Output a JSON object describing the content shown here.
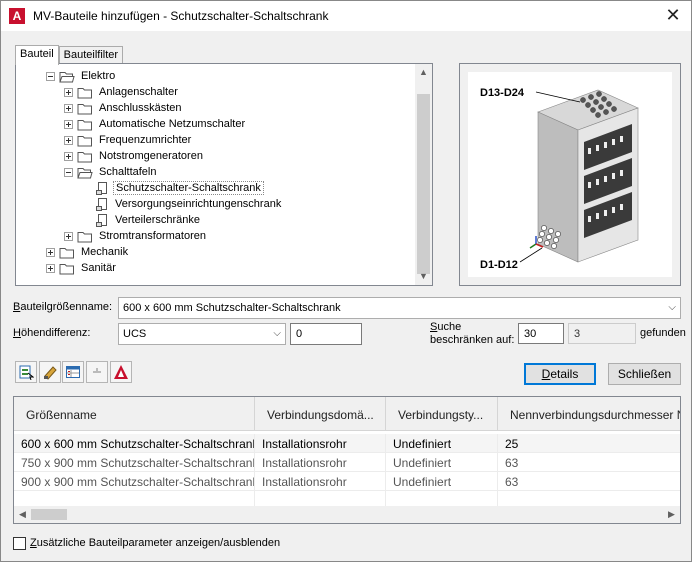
{
  "window": {
    "title": "MV-Bauteile hinzufügen - Schutzschalter-Schaltschrank",
    "app_icon_letter": "A",
    "close_glyph": "✕"
  },
  "tabs": [
    {
      "label": "Bauteil",
      "active": true
    },
    {
      "label": "Bauteilfilter",
      "active": false
    }
  ],
  "tree": [
    {
      "label": "Elektro",
      "level": 1,
      "expander": "minus",
      "icon": "folder-open"
    },
    {
      "label": "Anlagenschalter",
      "level": 2,
      "expander": "plus",
      "icon": "folder"
    },
    {
      "label": "Anschlusskästen",
      "level": 2,
      "expander": "plus",
      "icon": "folder"
    },
    {
      "label": "Automatische Netzumschalter",
      "level": 2,
      "expander": "plus",
      "icon": "folder"
    },
    {
      "label": "Frequenzumrichter",
      "level": 2,
      "expander": "plus",
      "icon": "folder"
    },
    {
      "label": "Notstromgeneratoren",
      "level": 2,
      "expander": "plus",
      "icon": "folder"
    },
    {
      "label": "Schalttafeln",
      "level": 2,
      "expander": "minus",
      "icon": "folder-open"
    },
    {
      "label": "Schutzschalter-Schaltschrank",
      "level": 3,
      "expander": "none",
      "icon": "file",
      "selected": true
    },
    {
      "label": "Versorgungseinrichtungenschrank",
      "level": 3,
      "expander": "none",
      "icon": "file"
    },
    {
      "label": "Verteilerschränke",
      "level": 3,
      "expander": "none",
      "icon": "file"
    },
    {
      "label": "Stromtransformatoren",
      "level": 2,
      "expander": "plus",
      "icon": "folder"
    },
    {
      "label": "Mechanik",
      "level": 1,
      "expander": "plus",
      "icon": "folder"
    },
    {
      "label": "Sanitär",
      "level": 1,
      "expander": "plus",
      "icon": "folder"
    }
  ],
  "preview": {
    "label_top": "D13-D24",
    "label_bottom": "D1-D12"
  },
  "form": {
    "size_label_u": "B",
    "size_label_rest": "auteilgrößenname:",
    "size_value": "600 x 600 mm Schutzschalter-Schaltschrank",
    "height_label_u": "H",
    "height_label_rest": "öhendifferenz:",
    "height_combo": "UCS",
    "height_value": "0",
    "search_label_line1_u": "S",
    "search_label_line1_rest": "uche",
    "search_label_line2": "beschränken auf:",
    "search_limit": "30",
    "found_count": "3",
    "found_label": "gefunden"
  },
  "toolbar": {
    "icons": [
      "add-part-icon",
      "paint-tool-icon",
      "table-view-icon",
      "disabled-tool-icon",
      "autocad-icon"
    ]
  },
  "buttons": {
    "details": "Details",
    "close": "Schließen"
  },
  "grid": {
    "columns": [
      "Größenname",
      "Verbindungsdomä...",
      "Verbindungsty...",
      "Nennverbindungsdurchmesser N"
    ],
    "rows": [
      [
        "600 x 600 mm Schutzschalter-Schaltschrank",
        "Installationsrohr",
        "Undefiniert",
        "25"
      ],
      [
        "750 x 900 mm Schutzschalter-Schaltschrank",
        "Installationsrohr",
        "Undefiniert",
        "63"
      ],
      [
        "900 x 900 mm Schutzschalter-Schaltschrank",
        "Installationsrohr",
        "Undefiniert",
        "63"
      ]
    ]
  },
  "footer": {
    "checkbox_label_u": "Z",
    "checkbox_label_rest": "usätzliche Bauteilparameter anzeigen/ausblenden",
    "checked": false
  }
}
